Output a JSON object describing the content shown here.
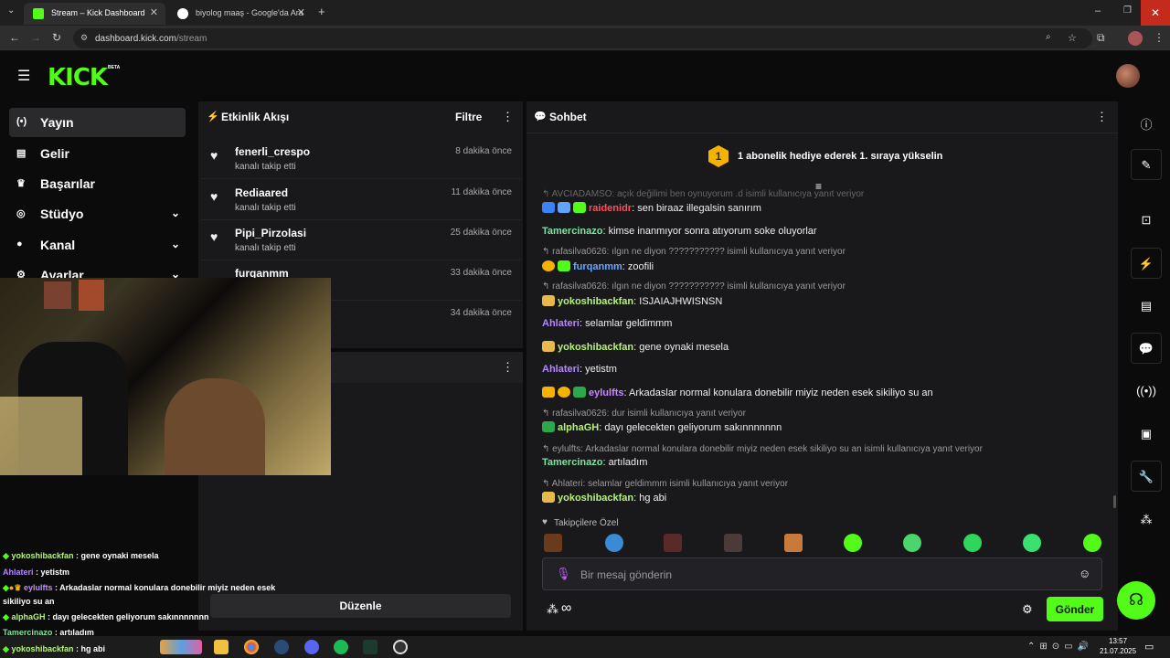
{
  "browser": {
    "tabs": [
      {
        "title": "Stream – Kick Dashboard",
        "active": true
      },
      {
        "title": "biyolog maaş - Google'da Ara",
        "active": false
      }
    ],
    "url_host": "dashboard.kick.com",
    "url_path": "/stream"
  },
  "brand": {
    "logo": "KICK",
    "badge": "BETA",
    "accent": "#53fc18"
  },
  "nav": [
    {
      "label": "Yayın",
      "icon": "broadcast-icon",
      "glyph": "(•)",
      "active": true,
      "chevron": false
    },
    {
      "label": "Gelir",
      "icon": "chart-icon",
      "glyph": "▤",
      "active": false,
      "chevron": false
    },
    {
      "label": "Başarılar",
      "icon": "trophy-icon",
      "glyph": "🏆",
      "active": false,
      "chevron": false
    },
    {
      "label": "Stüdyo",
      "icon": "studio-icon",
      "glyph": "◎",
      "active": false,
      "chevron": true
    },
    {
      "label": "Kanal",
      "icon": "person-icon",
      "glyph": "👤",
      "active": false,
      "chevron": true
    },
    {
      "label": "Ayarlar",
      "icon": "gear-icon",
      "glyph": "⚙",
      "active": false,
      "chevron": true
    }
  ],
  "activity": {
    "title": "Etkinlik Akışı",
    "filter": "Filtre",
    "events": [
      {
        "name": "fenerli_crespo",
        "action": "kanalı takip etti",
        "time": "8 dakika önce"
      },
      {
        "name": "Rediaared",
        "action": "kanalı takip etti",
        "time": "11 dakika önce"
      },
      {
        "name": "Pipi_Pirzolasi",
        "action": "kanalı takip etti",
        "time": "25 dakika önce"
      },
      {
        "name": "furqanmm",
        "action": "",
        "time": "33 dakika önce"
      },
      {
        "name": "",
        "action": "",
        "time": "34 dakika önce"
      }
    ],
    "edit_button": "Düzenle"
  },
  "chat": {
    "title": "Sohbet",
    "promo": "1 abonelik hediye ederek 1. sıraya yükselin",
    "promo_rank": "1",
    "messages": [
      {
        "reply": "AVCIADAMSO: açık değilimi ben oynuyorum .d isimli kullanıcıya yanıt veriyor"
      },
      {
        "user": "raidenidr",
        "color": "#ff4f5e",
        "text": "sen biraaz illegalsin sanırım",
        "badges": [
          "#3b82f6",
          "#3b82f6",
          "#53fc18"
        ]
      },
      {
        "user": "Tamercinazo",
        "color": "#7ee3a0",
        "text": "kimse inanmıyor sonra atıyorum soke oluyorlar",
        "badges": []
      },
      {
        "reply": "rafasilva0626: ılgın ne diyon ??????????? isimli kullanıcıya yanıt veriyor"
      },
      {
        "user": "furqanmm",
        "color": "#6aa8ff",
        "text": "zoofili",
        "badges": [
          "#f5b301",
          "#53fc18"
        ]
      },
      {
        "reply": "rafasilva0626: ılgın ne diyon ??????????? isimli kullanıcıya yanıt veriyor"
      },
      {
        "user": "yokoshibackfan",
        "color": "#b8f27c",
        "text": "ISJAIAJHWISNSN",
        "badges": [
          "#e8b84a"
        ]
      },
      {
        "user": "Ahlateri",
        "color": "#b388ff",
        "text": "selamlar geldimmm",
        "badges": []
      },
      {
        "user": "yokoshibackfan",
        "color": "#b8f27c",
        "text": "gene oynaki mesela",
        "badges": [
          "#e8b84a"
        ]
      },
      {
        "user": "Ahlateri",
        "color": "#b388ff",
        "text": "yetistm",
        "badges": []
      },
      {
        "user": "eylulfts",
        "color": "#c58aff",
        "text": "Arkadaslar normal konulara donebilir miyiz neden esek sikiliyo su an",
        "badges": [
          "#f5b301",
          "#f5b301",
          "#2aa84a"
        ]
      },
      {
        "reply": "rafasilva0626: dur isimli kullanıcıya yanıt veriyor"
      },
      {
        "user": "alphaGH",
        "color": "#b8f27c",
        "text": "dayı gelecekten geliyorum sakınnnnnnn",
        "badges": [
          "#2aa84a"
        ]
      },
      {
        "reply": "eylulfts: Arkadaslar normal konulara donebilir miyiz neden esek sikiliyo su an isimli kullanıcıya yanıt veriyor"
      },
      {
        "user": "Tamercinazo",
        "color": "#7ee3a0",
        "text": "artıladım",
        "badges": []
      },
      {
        "reply": "Ahlateri: selamlar geldimmm isimli kullanıcıya yanıt veriyor"
      },
      {
        "user": "yokoshibackfan",
        "color": "#b8f27c",
        "text": "hg abi",
        "badges": [
          "#e8b84a"
        ]
      }
    ],
    "followers_label": "Takipçilere Özel",
    "input_placeholder": "Bir mesaj gönderin",
    "send": "Gönder"
  },
  "overlay_chat": [
    {
      "user": "yokoshibackfan",
      "color": "#b8f27c",
      "text": ": gene oynaki mesela"
    },
    {
      "user": "Ahlateri",
      "color": "#b388ff",
      "text": ": yetistm"
    },
    {
      "user": "eylulfts",
      "color": "#c58aff",
      "text": ": Arkadaslar normal konulara donebilir miyiz neden esek"
    },
    {
      "user": "",
      "color": "#ffffff",
      "text": "sikiliyo su an"
    },
    {
      "user": "alphaGH",
      "color": "#b8f27c",
      "text": ": dayı gelecekten geliyorum sakınnnnnnn"
    },
    {
      "user": "Tamercinazo",
      "color": "#7ee3a0",
      "text": ": artıladım"
    },
    {
      "user": "yokoshibackfan",
      "color": "#b8f27c",
      "text": ": hg abi"
    }
  ],
  "taskbar": {
    "time": "13:57",
    "date": "21.07.2025"
  }
}
